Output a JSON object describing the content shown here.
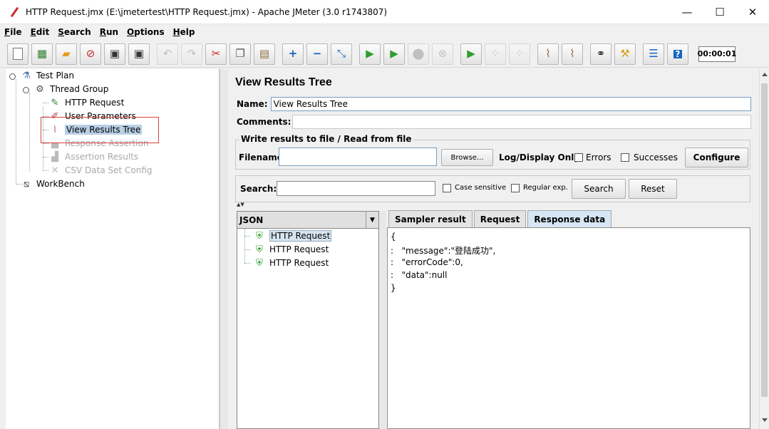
{
  "window": {
    "title": "HTTP Request.jmx (E:\\jmetertest\\HTTP Request.jmx) - Apache JMeter (3.0 r1743807)",
    "minimize": "—",
    "maximize": "☐",
    "close": "✕"
  },
  "menu": [
    {
      "accel": "F",
      "rest": "ile"
    },
    {
      "accel": "E",
      "rest": "dit"
    },
    {
      "accel": "S",
      "rest": "earch"
    },
    {
      "accel": "R",
      "rest": "un"
    },
    {
      "accel": "O",
      "rest": "ptions"
    },
    {
      "accel": "H",
      "rest": "elp"
    }
  ],
  "toolbar": {
    "timer": "00:00:01"
  },
  "tree": {
    "test_plan": "Test Plan",
    "thread_group": "Thread Group",
    "http_request": "HTTP Request",
    "user_parameters": "User Parameters",
    "view_results_tree": "View Results Tree",
    "response_assertion": "Response Assertion",
    "assertion_results": "Assertion Results",
    "csv_data_set_config": "CSV Data Set Config",
    "workbench": "WorkBench"
  },
  "panel": {
    "title": "View Results Tree",
    "name_label": "Name:",
    "name_value": "View Results Tree",
    "comments_label": "Comments:",
    "file_group_title": "Write results to file / Read from file",
    "filename_label": "Filename",
    "browse_button": "Browse...",
    "log_display_label": "Log/Display Only:",
    "errors_label": "Errors",
    "successes_label": "Successes",
    "configure_button": "Configure",
    "search_label": "Search:",
    "case_sensitive_label": "Case sensitive",
    "regular_exp_label": "Regular exp.",
    "search_button": "Search",
    "reset_button": "Reset",
    "renderer": "JSON",
    "results": [
      "HTTP Request",
      "HTTP Request",
      "HTTP Request"
    ],
    "tabs": [
      "Sampler result",
      "Request",
      "Response data"
    ],
    "response_lines": [
      "{",
      ":   \"message\":\"登陆成功\",",
      ":   \"errorCode\":0,",
      ":   \"data\":null",
      "}"
    ]
  }
}
